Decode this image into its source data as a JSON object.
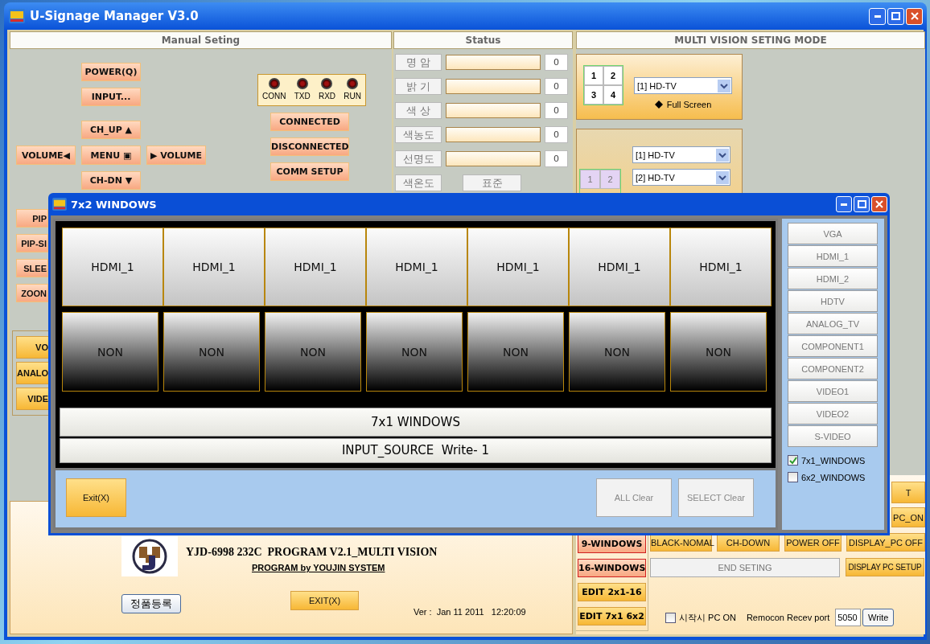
{
  "window": {
    "title": "U-Signage Manager V3.0"
  },
  "manual": {
    "title": "Manual Seting",
    "remote": [
      "POWER(Q)",
      "INPUT...",
      "CH_UP ▲",
      "VOLUME◀",
      "MENU ▣",
      "▶ VOLUME",
      "CH-DN ▼"
    ],
    "leds": [
      {
        "label": "CONN",
        "on": false
      },
      {
        "label": "TXD",
        "on": false
      },
      {
        "label": "RXD",
        "on": false
      },
      {
        "label": "RUN",
        "on": false
      }
    ],
    "comm_buttons": [
      "CONNECTED",
      "DISCONNECTED",
      "COMM SETUP"
    ],
    "side_buttons": [
      "PIP",
      "PIP-SI",
      "SLEE",
      "ZOON"
    ],
    "source_buttons": [
      "VO",
      "ANALO",
      "VIDE"
    ]
  },
  "status": {
    "title": "Status",
    "rows": [
      {
        "label": "명 암",
        "value": "0"
      },
      {
        "label": "밝 기",
        "value": "0"
      },
      {
        "label": "색 상",
        "value": "0"
      },
      {
        "label": "색농도",
        "value": "0"
      },
      {
        "label": "선명도",
        "value": "0"
      }
    ],
    "color_temp": {
      "label": "색온도",
      "button": "표준"
    }
  },
  "multi_vision": {
    "title": "MULTI VISION SETING MODE",
    "quad": {
      "cells": [
        "1",
        "2",
        "3",
        "4"
      ],
      "select": "[1] HD-TV",
      "option": "Full Screen"
    },
    "dual": {
      "cells": [
        "1",
        "2"
      ],
      "selects": [
        "[1] HD-TV",
        "[2] HD-TV"
      ]
    },
    "cut_buttons": [
      "T",
      "PC_ON"
    ],
    "mode_buttons": [
      {
        "label": "9-WINDOWS",
        "kind": "window"
      },
      {
        "label": "16-WINDOWS",
        "kind": "window"
      },
      {
        "label": "EDIT 2x1-16",
        "kind": "edit"
      },
      {
        "label": "EDIT 7x1 6x2",
        "kind": "edit"
      }
    ],
    "buttons": [
      "BLACK-NOMAL",
      "CH-DOWN",
      "POWER OFF",
      "DISPLAY_PC OFF"
    ],
    "end_button": "END SETING",
    "setup_button": "DISPLAY PC SETUP",
    "pc_on": {
      "label": "시작시 PC ON",
      "checked": false
    },
    "port": {
      "label": "Remocon Recev port",
      "value": "5050",
      "button": "Write"
    }
  },
  "about": {
    "title": "YJD-6998 232C  PROGRAM V2.1_MULTI VISION",
    "credit": "PROGRAM by YOUJIN SYSTEM",
    "register": "정품등록",
    "exit": "EXIT(X)",
    "version": "Ver :  Jan 11 2011   12:20:09"
  },
  "dialog": {
    "title": "7x2 WINDOWS",
    "top_row": [
      "HDMI_1",
      "HDMI_1",
      "HDMI_1",
      "HDMI_1",
      "HDMI_1",
      "HDMI_1",
      "HDMI_1"
    ],
    "bottom_row": [
      "NON",
      "NON",
      "NON",
      "NON",
      "NON",
      "NON",
      "NON"
    ],
    "mode_bar": "7x1 WINDOWS",
    "source_bar": "INPUT_SOURCE  Write- 1",
    "exit": "Exit(X)",
    "clear_buttons": [
      "ALL Clear",
      "SELECT Clear"
    ],
    "sources": [
      "VGA",
      "HDMI_1",
      "HDMI_2",
      "HDTV",
      "ANALOG_TV",
      "COMPONENT1",
      "COMPONENT2",
      "VIDEO1",
      "VIDEO2",
      "S-VIDEO"
    ],
    "layouts": [
      {
        "label": "7x1_WINDOWS",
        "checked": true
      },
      {
        "label": "6x2_WINDOWS",
        "checked": false
      }
    ]
  }
}
